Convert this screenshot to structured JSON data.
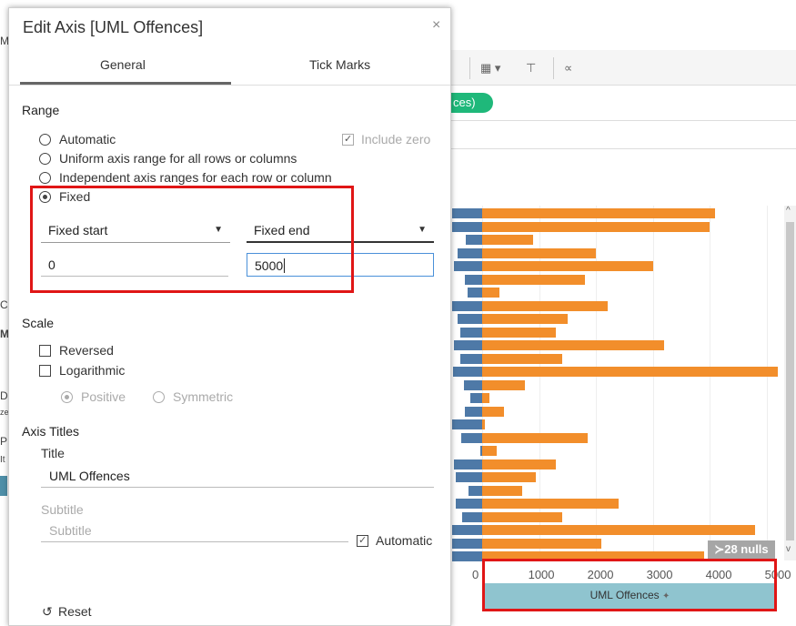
{
  "dialog": {
    "title": "Edit Axis [UML Offences]",
    "close_glyph": "×",
    "tabs": [
      {
        "label": "General"
      },
      {
        "label": "Tick Marks"
      }
    ],
    "range": {
      "title": "Range",
      "options": [
        {
          "label": "Automatic",
          "selected": false
        },
        {
          "label": "Uniform axis range for all rows or columns",
          "selected": false
        },
        {
          "label": "Independent axis ranges for each row or column",
          "selected": false
        },
        {
          "label": "Fixed",
          "selected": true
        }
      ],
      "include_zero": {
        "label": "Include zero",
        "checked": true,
        "disabled": true
      },
      "fixed_start": {
        "label": "Fixed start",
        "value": "0"
      },
      "fixed_end": {
        "label": "Fixed end",
        "value": "5000"
      }
    },
    "scale": {
      "title": "Scale",
      "reversed": {
        "label": "Reversed",
        "checked": false
      },
      "logarithmic": {
        "label": "Logarithmic",
        "checked": false
      },
      "positive": {
        "label": "Positive",
        "selected": true
      },
      "symmetric": {
        "label": "Symmetric",
        "selected": false
      }
    },
    "axis_titles": {
      "title": "Axis Titles",
      "title_label": "Title",
      "title_value": "UML Offences",
      "subtitle_label": "Subtitle",
      "subtitle_placeholder": "Subtitle",
      "automatic": {
        "label": "Automatic",
        "checked": true
      }
    },
    "reset": {
      "icon": "reset-icon",
      "glyph": "↺",
      "label": "Reset"
    }
  },
  "background": {
    "pill_text": "ces)",
    "side_letters": [
      "M",
      "C",
      "M",
      "D",
      "ze",
      "P",
      "It",
      "C"
    ],
    "nulls_badge": "≻28 nulls",
    "axis_title": "UML Offences",
    "pin_glyph": "✦",
    "colors": {
      "blue": "#4e79a7",
      "orange": "#f28e2b",
      "teal": "#8fc4cf",
      "highlight": "#e01616",
      "pill": "#1fb87a"
    }
  },
  "chart_data": {
    "type": "bar",
    "orientation": "horizontal",
    "xlabel": "UML Offences",
    "xlim": [
      0,
      5000
    ],
    "ticks": [
      "0",
      "1000",
      "2000",
      "3000",
      "4000",
      "5000"
    ],
    "series": [
      {
        "values": [
          4100,
          4000,
          900,
          2000,
          3000,
          1800,
          300,
          2200,
          1500,
          1300,
          3200,
          1400,
          5200,
          750,
          120,
          380,
          40,
          1850,
          250,
          1300,
          950,
          700,
          2400,
          1400,
          4800,
          2100,
          3900
        ]
      },
      {
        "values": [
          520,
          520,
          280,
          420,
          480,
          300,
          250,
          520,
          420,
          380,
          480,
          380,
          500,
          320,
          200,
          300,
          520,
          360,
          30,
          480,
          460,
          240,
          460,
          350,
          520,
          520,
          520
        ]
      }
    ]
  }
}
